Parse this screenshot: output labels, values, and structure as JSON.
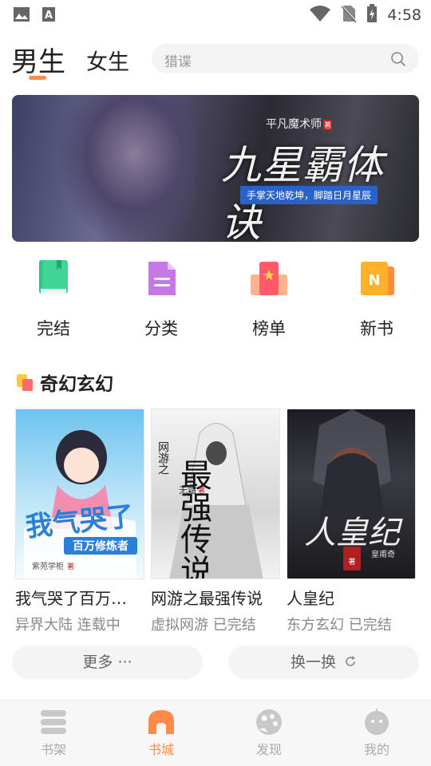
{
  "status_bar": {
    "time": "4:58",
    "icons": [
      "image-icon",
      "text-a-icon",
      "wifi-icon",
      "no-sim-icon",
      "battery-charging-icon"
    ]
  },
  "header": {
    "tabs": [
      {
        "label": "男生",
        "active": true
      },
      {
        "label": "女生",
        "active": false
      }
    ],
    "search": {
      "placeholder": "猎谍",
      "icon": "search-icon"
    },
    "accent_color": "#ff8a4a"
  },
  "banner": {
    "author": "平凡魔术师",
    "author_badge": "著",
    "title": "九星霸体诀",
    "subtitle": "手掌天地乾坤，脚踏日月星辰"
  },
  "categories": [
    {
      "label": "完结",
      "icon": "book-green-icon"
    },
    {
      "label": "分类",
      "icon": "document-purple-icon"
    },
    {
      "label": "榜单",
      "icon": "ranking-red-icon"
    },
    {
      "label": "新书",
      "icon": "new-book-orange-icon"
    }
  ],
  "section": {
    "title": "奇幻玄幻",
    "books": [
      {
        "title": "我气哭了百万…",
        "genre": "异界大陆",
        "status": "连载中",
        "cover_text": "我气哭了",
        "cover_sub": "百万修炼者",
        "cover_author": "紫苑学柜",
        "cover_author_badge": "著"
      },
      {
        "title": "网游之最强传说",
        "genre": "虚拟网游",
        "status": "已完结",
        "cover_text": "最强传说",
        "cover_prefix": "网游之",
        "cover_author": "无霜",
        "cover_author_badge": "著"
      },
      {
        "title": "人皇纪",
        "genre": "东方玄幻",
        "status": "已完结",
        "cover_text": "人皇纪",
        "cover_author": "皇甫奇",
        "cover_author_badge": "著"
      }
    ],
    "more_label": "更多 ···",
    "refresh_label": "换一换"
  },
  "bottom_nav": [
    {
      "label": "书架",
      "icon": "bookshelf-icon",
      "active": false
    },
    {
      "label": "书城",
      "icon": "bookstore-icon",
      "active": true
    },
    {
      "label": "发现",
      "icon": "discover-icon",
      "active": false
    },
    {
      "label": "我的",
      "icon": "profile-icon",
      "active": false
    }
  ]
}
